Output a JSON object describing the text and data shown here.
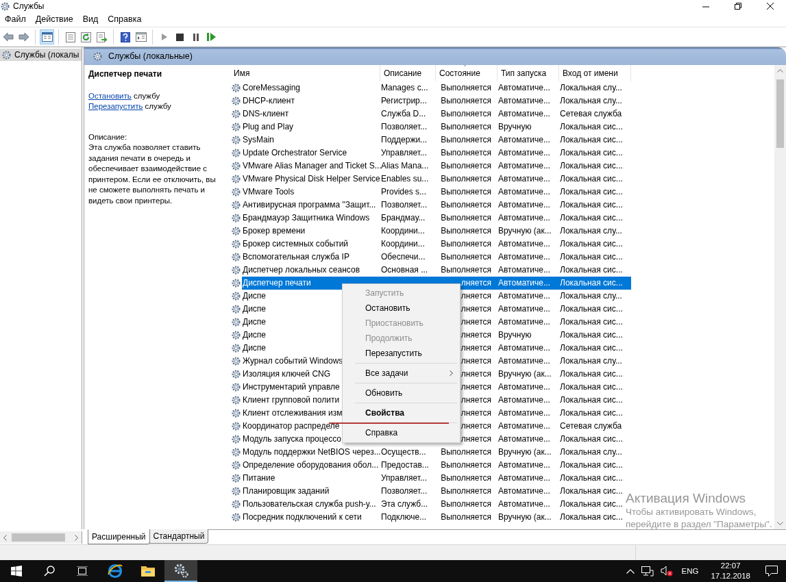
{
  "window": {
    "title": "Службы"
  },
  "menu_bar": [
    "Файл",
    "Действие",
    "Вид",
    "Справка"
  ],
  "tree": {
    "items": [
      {
        "label": "Службы (локалы",
        "selected": true
      }
    ]
  },
  "panel_header": {
    "title": "Службы (локальные)"
  },
  "details": {
    "title": "Диспетчер печати",
    "actions": [
      {
        "link": "Остановить",
        "text": " службу"
      },
      {
        "link": "Перезапустить",
        "text": " службу"
      }
    ],
    "description_label": "Описание:",
    "description": "Эта служба позволяет ставить задания печати в очередь и обеспечивает взаимодействие с принтером. Если ее отключить, вы не сможете выполнять печать и видеть свои принтеры."
  },
  "table": {
    "columns": [
      {
        "label": "Имя",
        "sorted": false
      },
      {
        "label": "Описание",
        "sorted": false
      },
      {
        "label": "Состояние",
        "sorted": true
      },
      {
        "label": "Тип запуска",
        "sorted": false
      },
      {
        "label": "Вход от имени",
        "sorted": false
      }
    ],
    "rows": [
      {
        "name": "CoreMessaging",
        "description": "Manages c...",
        "status": "Выполняется",
        "startup": "Автоматиче...",
        "logon": "Локальная слу...",
        "selected": false
      },
      {
        "name": "DHCP-клиент",
        "description": "Регистрир...",
        "status": "Выполняется",
        "startup": "Автоматиче...",
        "logon": "Локальная слу...",
        "selected": false
      },
      {
        "name": "DNS-клиент",
        "description": "Служба D...",
        "status": "Выполняется",
        "startup": "Автоматиче...",
        "logon": "Сетевая служба",
        "selected": false
      },
      {
        "name": "Plug and Play",
        "description": "Позволяет...",
        "status": "Выполняется",
        "startup": "Вручную",
        "logon": "Локальная сис...",
        "selected": false
      },
      {
        "name": "SysMain",
        "description": "Поддержи...",
        "status": "Выполняется",
        "startup": "Автоматиче...",
        "logon": "Локальная сис...",
        "selected": false
      },
      {
        "name": "Update Orchestrator Service",
        "description": "Управляет...",
        "status": "Выполняется",
        "startup": "Автоматиче...",
        "logon": "Локальная сис...",
        "selected": false
      },
      {
        "name": "VMware Alias Manager and Ticket S...",
        "description": "Alias Mana...",
        "status": "Выполняется",
        "startup": "Автоматиче...",
        "logon": "Локальная сис...",
        "selected": false
      },
      {
        "name": "VMware Physical Disk Helper Service",
        "description": "Enables su...",
        "status": "Выполняется",
        "startup": "Автоматиче...",
        "logon": "Локальная сис...",
        "selected": false
      },
      {
        "name": "VMware Tools",
        "description": "Provides s...",
        "status": "Выполняется",
        "startup": "Автоматиче...",
        "logon": "Локальная сис...",
        "selected": false
      },
      {
        "name": "Антивирусная программа \"Защит...",
        "description": "Позволяет...",
        "status": "Выполняется",
        "startup": "Автоматиче...",
        "logon": "Локальная сис...",
        "selected": false
      },
      {
        "name": "Брандмауэр Защитника Windows",
        "description": "Брандмау...",
        "status": "Выполняется",
        "startup": "Автоматиче...",
        "logon": "Локальная сис...",
        "selected": false
      },
      {
        "name": "Брокер времени",
        "description": "Координи...",
        "status": "Выполняется",
        "startup": "Вручную (ак...",
        "logon": "Локальная слу...",
        "selected": false
      },
      {
        "name": "Брокер системных событий",
        "description": "Координи...",
        "status": "Выполняется",
        "startup": "Автоматиче...",
        "logon": "Локальная сис...",
        "selected": false
      },
      {
        "name": "Вспомогательная служба IP",
        "description": "Обеспечи...",
        "status": "Выполняется",
        "startup": "Автоматиче...",
        "logon": "Локальная сис...",
        "selected": false
      },
      {
        "name": "Диспетчер локальных сеансов",
        "description": "Основная ...",
        "status": "Выполняется",
        "startup": "Автоматиче...",
        "logon": "Локальная сис...",
        "selected": false
      },
      {
        "name": "Диспетчер печати",
        "status": "лняется",
        "startup": "Автоматиче...",
        "logon": "Локальная сис...",
        "selected": true
      },
      {
        "name": "Диспе",
        "status": "лняется",
        "startup": "Автоматиче...",
        "logon": "Локальная слу...",
        "selected": false
      },
      {
        "name": "Диспе",
        "status": "лняется",
        "startup": "Автоматиче...",
        "logon": "Локальная сис...",
        "selected": false
      },
      {
        "name": "Диспе",
        "status": "лняется",
        "startup": "Автоматиче...",
        "logon": "Локальная сис...",
        "selected": false
      },
      {
        "name": "Диспе",
        "status": "лняется",
        "startup": "Вручную",
        "logon": "Локальная сис...",
        "selected": false
      },
      {
        "name": "Диспе",
        "status": "лняется",
        "startup": "Автоматиче...",
        "logon": "Локальная сис...",
        "selected": false
      },
      {
        "name": "Журнал событий Windows",
        "status": "лняется",
        "startup": "Автоматиче...",
        "logon": "Локальная слу...",
        "selected": false
      },
      {
        "name": "Изоляция ключей CNG",
        "status": "лняется",
        "startup": "Вручную (ак...",
        "logon": "Локальная сис...",
        "selected": false
      },
      {
        "name": "Инструментарий управле",
        "status": "лняется",
        "startup": "Автоматиче...",
        "logon": "Локальная сис...",
        "selected": false
      },
      {
        "name": "Клиент групповой полити",
        "status": "лняется",
        "startup": "Автоматиче...",
        "logon": "Локальная сис...",
        "selected": false
      },
      {
        "name": "Клиент отслеживания изм",
        "status": "лняется",
        "startup": "Автоматиче...",
        "logon": "Локальная сис...",
        "selected": false
      },
      {
        "name": "Координатор распределе",
        "status": "лняется",
        "startup": "Автоматиче...",
        "logon": "Сетевая служба",
        "selected": false
      },
      {
        "name": "Модуль запуска процессо",
        "status": "лняется",
        "startup": "Автоматиче...",
        "logon": "Локальная сис...",
        "selected": false
      },
      {
        "name": "Модуль поддержки NetBIOS через...",
        "description": "Осуществ...",
        "status": "Выполняется",
        "startup": "Вручную (ак...",
        "logon": "Локальная слу...",
        "selected": false
      },
      {
        "name": "Определение оборудования обол...",
        "description": "Предостав...",
        "status": "Выполняется",
        "startup": "Автоматиче...",
        "logon": "Локальная сис...",
        "selected": false
      },
      {
        "name": "Питание",
        "description": "Управляет...",
        "status": "Выполняется",
        "startup": "Автоматиче...",
        "logon": "Локальная сис...",
        "selected": false
      },
      {
        "name": "Планировщик заданий",
        "description": "Позволяет...",
        "status": "Выполняется",
        "startup": "Автоматиче...",
        "logon": "Локальная сис...",
        "selected": false
      },
      {
        "name": "Пользовательская служба push-у...",
        "description": "Эта служб...",
        "status": "Выполняется",
        "startup": "Автоматиче...",
        "logon": "Локальная сис...",
        "selected": false
      },
      {
        "name": "Посредник подключений к сети",
        "description": "Подключе...",
        "status": "Выполняется",
        "startup": "Вручную (ак...",
        "logon": "Локальная сис...",
        "selected": false
      }
    ]
  },
  "context_menu": {
    "items": [
      {
        "kind": "item",
        "label": "Запустить",
        "disabled": true,
        "default": false,
        "underlined": false
      },
      {
        "kind": "item",
        "label": "Остановить",
        "disabled": false,
        "default": false,
        "underlined": false
      },
      {
        "kind": "item",
        "label": "Приостановить",
        "disabled": true,
        "default": false,
        "underlined": false
      },
      {
        "kind": "item",
        "label": "Продолжить",
        "disabled": true,
        "default": false,
        "underlined": false
      },
      {
        "kind": "item",
        "label": "Перезапустить",
        "disabled": false,
        "default": false,
        "underlined": false
      },
      {
        "kind": "separator"
      },
      {
        "kind": "submenu",
        "label": "Все задачи",
        "disabled": false,
        "default": false,
        "underlined": false
      },
      {
        "kind": "separator"
      },
      {
        "kind": "item",
        "label": "Обновить",
        "disabled": false,
        "default": false,
        "underlined": false
      },
      {
        "kind": "separator"
      },
      {
        "kind": "item",
        "label": "Свойства",
        "disabled": false,
        "default": true,
        "underlined": true
      },
      {
        "kind": "separator"
      },
      {
        "kind": "item",
        "label": "Справка",
        "disabled": false,
        "default": false,
        "underlined": false
      }
    ]
  },
  "view_tabs": [
    {
      "label": "Расширенный",
      "selected": true
    },
    {
      "label": "Стандартный",
      "selected": false
    }
  ],
  "taskbar": {
    "apps": [
      {
        "active": false
      },
      {
        "active": false
      },
      {
        "active": true
      }
    ],
    "language": "ENG",
    "time": "22:07",
    "date": "17.12.2018"
  },
  "activation_notice": {
    "title": "Активация Windows",
    "lines": [
      "Чтобы активировать Windows,",
      "перейдите в раздел \"Параметры\"."
    ]
  }
}
